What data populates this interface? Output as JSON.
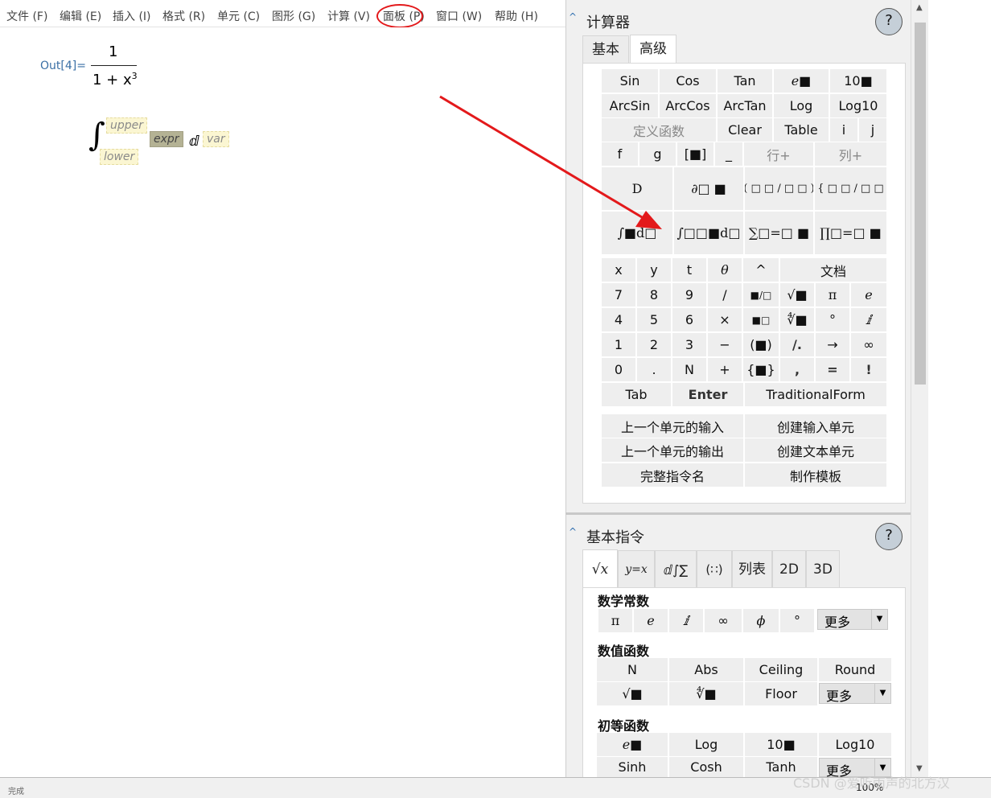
{
  "menu": [
    "文件 (F)",
    "编辑 (E)",
    "插入 (I)",
    "格式 (R)",
    "单元 (C)",
    "图形 (G)",
    "计算 (V)",
    "面板 (P)",
    "窗口 (W)",
    "帮助 (H)"
  ],
  "notebook": {
    "out_label": "Out[4]=",
    "numerator": "1",
    "denominator": "1 + x",
    "exponent": "3",
    "integral_sign": "∫",
    "upper": "upper",
    "lower": "lower",
    "expr": "expr",
    "d": "ⅆ",
    "var": "var"
  },
  "calculator": {
    "title": "计算器",
    "help": "?",
    "tabs": [
      "基本",
      "高级"
    ],
    "row1": [
      "Sin",
      "Cos",
      "Tan",
      "e■",
      "10■"
    ],
    "row2": [
      "ArcSin",
      "ArcCos",
      "ArcTan",
      "Log",
      "Log10"
    ],
    "row3": [
      "定义函数",
      "Clear",
      "Table",
      "i",
      "j"
    ],
    "row4": [
      "f",
      "g",
      "[■]",
      "_",
      "行+",
      "列+"
    ],
    "row5": [
      "D",
      "∂□ ■",
      "( □ □ / □ □ )",
      "{ □ □ / □ □"
    ],
    "row6": [
      "∫■d□",
      "∫□□■d□",
      "∑□=□ ■",
      "∏□=□ ■"
    ],
    "keypad": [
      [
        "x",
        "y",
        "t",
        "θ",
        "^",
        "文档"
      ],
      [
        "7",
        "8",
        "9",
        "/",
        "■/□",
        "√■",
        "π",
        "e"
      ],
      [
        "4",
        "5",
        "6",
        "×",
        "■□",
        "∜■",
        "°",
        "ⅈ"
      ],
      [
        "1",
        "2",
        "3",
        "−",
        "(■)",
        "/.",
        "→",
        "∞"
      ],
      [
        "0",
        ".",
        "N",
        "+",
        "{■}",
        ",",
        "=",
        "!"
      ]
    ],
    "bottom_row": [
      "Tab",
      "Enter",
      "TraditionalForm"
    ],
    "actions": [
      "上一个单元的输入",
      "创建输入单元",
      "上一个单元的输出",
      "创建文本单元",
      "完整指令名",
      "制作模板"
    ]
  },
  "basic_commands": {
    "title": "基本指令",
    "help": "?",
    "tabs": [
      "√x",
      "y=x",
      "ⅆ∫∑",
      "(∷)",
      "列表",
      "2D",
      "3D"
    ],
    "constants_label": "数学常数",
    "constants": [
      "π",
      "e",
      "ⅈ",
      "∞",
      "ϕ",
      "°"
    ],
    "more": "更多",
    "numeric_label": "数值函数",
    "numeric_row1": [
      "N",
      "Abs",
      "Ceiling",
      "Round"
    ],
    "numeric_row2": [
      "√■",
      "∜■",
      "Floor"
    ],
    "elementary_label": "初等函数",
    "elem_row1": [
      "e■",
      "Log",
      "10■",
      "Log10"
    ],
    "elem_row2": [
      "Sinh",
      "Cosh",
      "Tanh"
    ]
  },
  "status": {
    "zoom": "100%",
    "left": "完成",
    "watermark": "CSDN @爱听雨声的北方汉"
  },
  "colors": {
    "annotation_red": "#e3191b",
    "out_label_blue": "#3a6fa5"
  }
}
